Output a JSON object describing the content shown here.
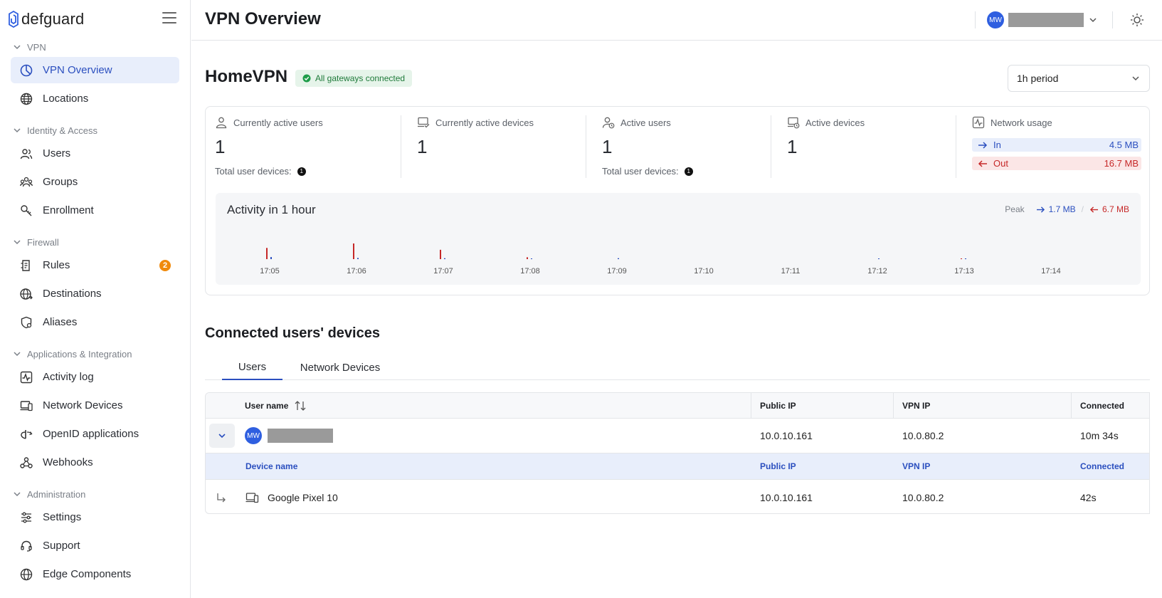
{
  "app": {
    "brand": "defguard"
  },
  "sidebar": {
    "sections": {
      "vpn": "VPN",
      "identity": "Identity & Access",
      "firewall": "Firewall",
      "apps": "Applications & Integration",
      "admin": "Administration"
    },
    "items": {
      "vpn_overview": "VPN Overview",
      "locations": "Locations",
      "users": "Users",
      "groups": "Groups",
      "enrollment": "Enrollment",
      "rules": "Rules",
      "rules_badge": "2",
      "destinations": "Destinations",
      "aliases": "Aliases",
      "activity_log": "Activity log",
      "network_devices": "Network Devices",
      "openid": "OpenID applications",
      "webhooks": "Webhooks",
      "settings": "Settings",
      "support": "Support",
      "edge": "Edge Components"
    }
  },
  "header": {
    "title": "VPN Overview",
    "user_initials": "MW"
  },
  "overview": {
    "vpn_name": "HomeVPN",
    "gateway_status": "All gateways connected",
    "period": "1h period",
    "stats": {
      "current_users_label": "Currently active users",
      "current_users_value": "1",
      "current_users_sub": "Total user devices:",
      "current_users_sub_count": "1",
      "current_devices_label": "Currently active devices",
      "current_devices_value": "1",
      "active_users_label": "Active users",
      "active_users_value": "1",
      "active_users_sub": "Total user devices:",
      "active_users_sub_count": "1",
      "active_devices_label": "Active devices",
      "active_devices_value": "1",
      "network_usage_label": "Network usage",
      "in_label": "In",
      "in_value": "4.5 MB",
      "out_label": "Out",
      "out_value": "16.7 MB"
    },
    "activity": {
      "title": "Activity in 1 hour",
      "peak_label": "Peak",
      "peak_in": "1.7 MB",
      "peak_out": "6.7 MB"
    }
  },
  "chart_data": {
    "type": "bar",
    "categories": [
      "17:05",
      "17:06",
      "17:07",
      "17:08",
      "17:09",
      "17:10",
      "17:11",
      "17:12",
      "17:13",
      "17:14"
    ],
    "series": [
      {
        "name": "In",
        "values": [
          0.9,
          0.5,
          0.4,
          0.1,
          0.4,
          0,
          0,
          0.05,
          0.05,
          0
        ],
        "color": "#2b4fbf"
      },
      {
        "name": "Out",
        "values": [
          4.8,
          6.7,
          4.0,
          0.8,
          0,
          0,
          0,
          0,
          0.05,
          0
        ],
        "color": "#c62828"
      }
    ],
    "ylim": [
      0,
      6.7
    ],
    "grid": false
  },
  "devices": {
    "title": "Connected users' devices",
    "tabs": [
      "Users",
      "Network Devices"
    ],
    "columns": {
      "user_name": "User name",
      "public_ip": "Public IP",
      "vpn_ip": "VPN IP",
      "connected": "Connected"
    },
    "user_row": {
      "initials": "MW",
      "public_ip": "10.0.10.161",
      "vpn_ip": "10.0.80.2",
      "connected": "10m 34s"
    },
    "sub_columns": {
      "device_name": "Device name",
      "public_ip": "Public IP",
      "vpn_ip": "VPN IP",
      "connected": "Connected"
    },
    "device_row": {
      "name": "Google Pixel 10",
      "public_ip": "10.0.10.161",
      "vpn_ip": "10.0.80.2",
      "connected": "42s"
    }
  },
  "colors": {
    "accent": "#2b4fbf",
    "in": "#2b4fbf",
    "out": "#c62828",
    "success": "#1f7a3a",
    "badge": "#f08a0c"
  }
}
